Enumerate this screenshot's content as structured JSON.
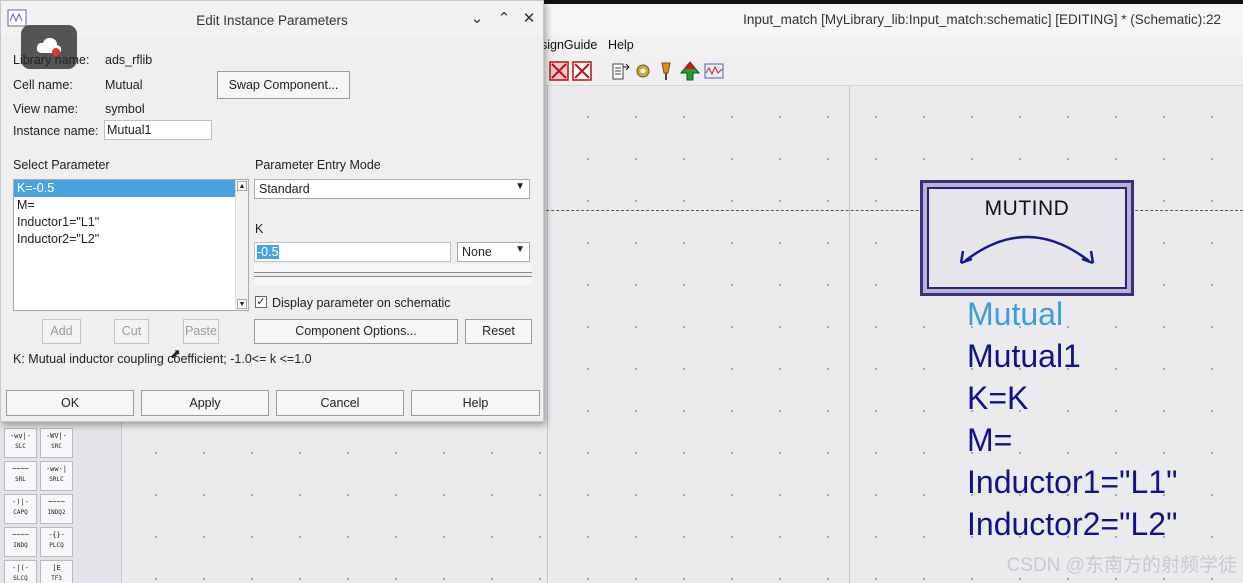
{
  "schematic_window": {
    "title": "Input_match [MyLibrary_lib:Input_match:schematic] [EDITING] * (Schematic):22",
    "menu": {
      "design_guide": "signGuide",
      "help": "Help"
    },
    "palette_items": [
      {
        "symbol": "-wv|-",
        "label": "SLC"
      },
      {
        "symbol": "-WV|-",
        "label": "SRC"
      },
      {
        "symbol": "~~~~",
        "label": "SRL"
      },
      {
        "symbol": "-ww-|",
        "label": "SRLC"
      },
      {
        "symbol": "-)|-",
        "label": "CAPQ"
      },
      {
        "symbol": "~~~~",
        "label": "INDQ2"
      },
      {
        "symbol": "~~~~",
        "label": "INDQ"
      },
      {
        "symbol": "-{}-",
        "label": "PLCQ"
      },
      {
        "symbol": "-|(-",
        "label": "SLCQ"
      },
      {
        "symbol": "]E",
        "label": "TF3"
      }
    ],
    "component": {
      "symbol_label": "MUTIND",
      "lines": [
        "Mutual",
        "Mutual1",
        "K=K",
        "M=",
        "Inductor1=\"L1\"",
        "Inductor2=\"L2\""
      ]
    },
    "watermark": "CSDN @东南方的射频学徒"
  },
  "dialog": {
    "title": "Edit Instance Parameters",
    "library_label": "Library name:",
    "library_value": "ads_rflib",
    "cell_label": "Cell name:",
    "cell_value": "Mutual",
    "view_label": "View name:",
    "view_value": "symbol",
    "instance_label": "Instance name:",
    "instance_value": "Mutual1",
    "swap_button": "Swap Component...",
    "select_parameter_label": "Select Parameter",
    "parameters": [
      "K=-0.5",
      "M=",
      "Inductor1=\"L1\"",
      "Inductor2=\"L2\""
    ],
    "entry_mode_label": "Parameter Entry Mode",
    "entry_mode_value": "Standard",
    "param_name_label": "K",
    "param_value": "-0.5",
    "unit_value": "None",
    "display_checkbox_label": "Display parameter on schematic",
    "display_checked": true,
    "add_button": "Add",
    "cut_button": "Cut",
    "paste_button": "Paste",
    "component_options_button": "Component Options...",
    "reset_button": "Reset",
    "hint": "K: Mutual inductor coupling coefficient; -1.0<= k <=1.0",
    "ok_button": "OK",
    "apply_button": "Apply",
    "cancel_button": "Cancel",
    "help_button": "Help"
  }
}
